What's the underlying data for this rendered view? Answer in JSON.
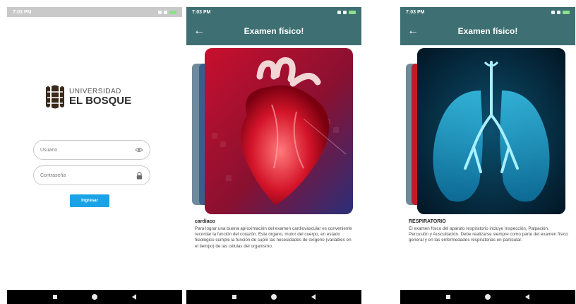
{
  "screens": {
    "login": {
      "status_time": "7:03 PM",
      "logo": {
        "line1": "UNIVERSIDAD",
        "line2": "EL BOSQUE"
      },
      "username": {
        "placeholder": "Usuario"
      },
      "password": {
        "placeholder": "Contraseña"
      },
      "submit_label": "Ingresar"
    },
    "cardiac": {
      "status_time": "7:03 PM",
      "appbar_title": "Examen físico!",
      "card_title": "cardiaco",
      "card_description": "Para lograr una buena aproximación del examen cardiovascular es conveniente recordar la función del corazón. Este órgano, motor del cuerpo, en estado fisiológico cumple la función de suplir las necesidades de oxígeno (variables en el tiempo) de las células del organismo."
    },
    "respiratory": {
      "status_time": "7:03 PM",
      "appbar_title": "Examen físico!",
      "card_title": "RESPIRATORIO",
      "card_description": "El examen físico del aparato respiratorio incluye Inspección, Palpación, Percusión y Auscultación. Debe realizarse siempre como parte del examen físico general y en las enfermedades respiratorias en particular."
    }
  },
  "colors": {
    "appbar": "#3e6f72",
    "button": "#1aa3e6",
    "navbar": "#000000"
  },
  "icons": {
    "username": "eye-icon",
    "password": "lock-icon",
    "back": "arrow-left-icon"
  }
}
